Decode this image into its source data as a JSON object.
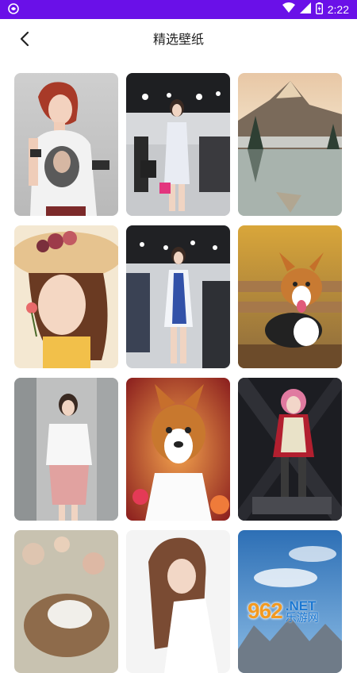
{
  "status": {
    "time": "2:22",
    "colors": {
      "bar": "#6a10e8"
    },
    "icons": [
      "app-icon",
      "wifi-icon",
      "signal-icon",
      "battery-icon"
    ]
  },
  "header": {
    "title": "精选壁纸",
    "back_icon": "chevron-left-icon"
  },
  "wallpapers": [
    {
      "subject": "woman in red hair and graphic t-shirt"
    },
    {
      "subject": "model at auto show"
    },
    {
      "subject": "mountain lake landscape"
    },
    {
      "subject": "woman with straw hat and flowers"
    },
    {
      "subject": "model in blue and white dress at auto show"
    },
    {
      "subject": "corgi on wooden bench"
    },
    {
      "subject": "woman in white jacket and pink skirt"
    },
    {
      "subject": "corgi close-up with flowers"
    },
    {
      "subject": "anime girl dark background"
    },
    {
      "subject": "puppy blurred background"
    },
    {
      "subject": "woman with wavy hair"
    },
    {
      "subject": "mountains under blue sky"
    }
  ],
  "watermark": {
    "number": "962",
    "net": ".NET",
    "site": "乐游网"
  }
}
